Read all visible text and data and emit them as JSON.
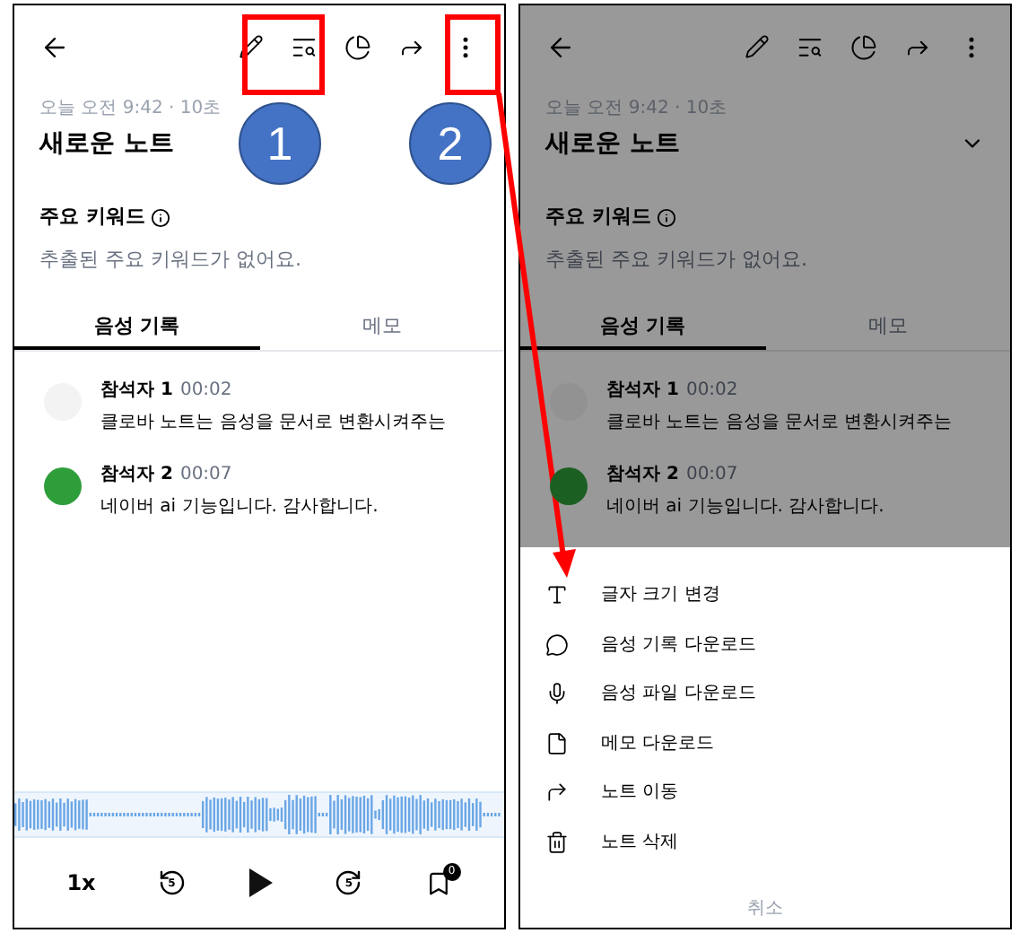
{
  "screens": [
    {
      "dimmed": false,
      "title_chevron": false,
      "timestamp": "오늘 오전 9:42 · 10초",
      "title": "새로운 노트",
      "keywords_label": "주요 키워드",
      "keywords_empty": "추출된 주요 키워드가 없어요.",
      "tabs": [
        {
          "label": "음성 기록",
          "selected": true
        },
        {
          "label": "메모",
          "selected": false
        }
      ],
      "transcript": [
        {
          "speaker": "참석자 1",
          "time": "00:02",
          "text": "클로바 노트는 음성을 문서로 변환시켜주는",
          "color": "#f3f3f3"
        },
        {
          "speaker": "참석자 2",
          "time": "00:07",
          "text": "네이버 ai 기능입니다. 감사합니다.",
          "color": "#2e9e3a"
        }
      ],
      "player": {
        "speed": "1x",
        "skip_back": "5",
        "skip_forward": "5",
        "bookmark_count": "0"
      }
    },
    {
      "dimmed": true,
      "title_chevron": true,
      "timestamp": "오늘 오전 9:42 · 10초",
      "title": "새로운 노트",
      "keywords_label": "주요 키워드",
      "keywords_empty": "추출된 주요 키워드가 없어요.",
      "tabs": [
        {
          "label": "음성 기록",
          "selected": true
        },
        {
          "label": "메모",
          "selected": false
        }
      ],
      "transcript": [
        {
          "speaker": "참석자 1",
          "time": "00:02",
          "text": "클로바 노트는 음성을 문서로 변환시켜주는",
          "color": "#929292"
        },
        {
          "speaker": "참석자 2",
          "time": "00:07",
          "text": "네이버 ai 기능입니다. 감사합니다.",
          "color": "#1c5f23"
        }
      ],
      "menu": {
        "items": [
          "글자 크기 변경",
          "음성 기록 다운로드",
          "음성 파일 다운로드",
          "메모 다운로드",
          "노트 이동",
          "노트 삭제"
        ],
        "cancel": "취소"
      }
    }
  ],
  "callouts": [
    "1",
    "2"
  ]
}
